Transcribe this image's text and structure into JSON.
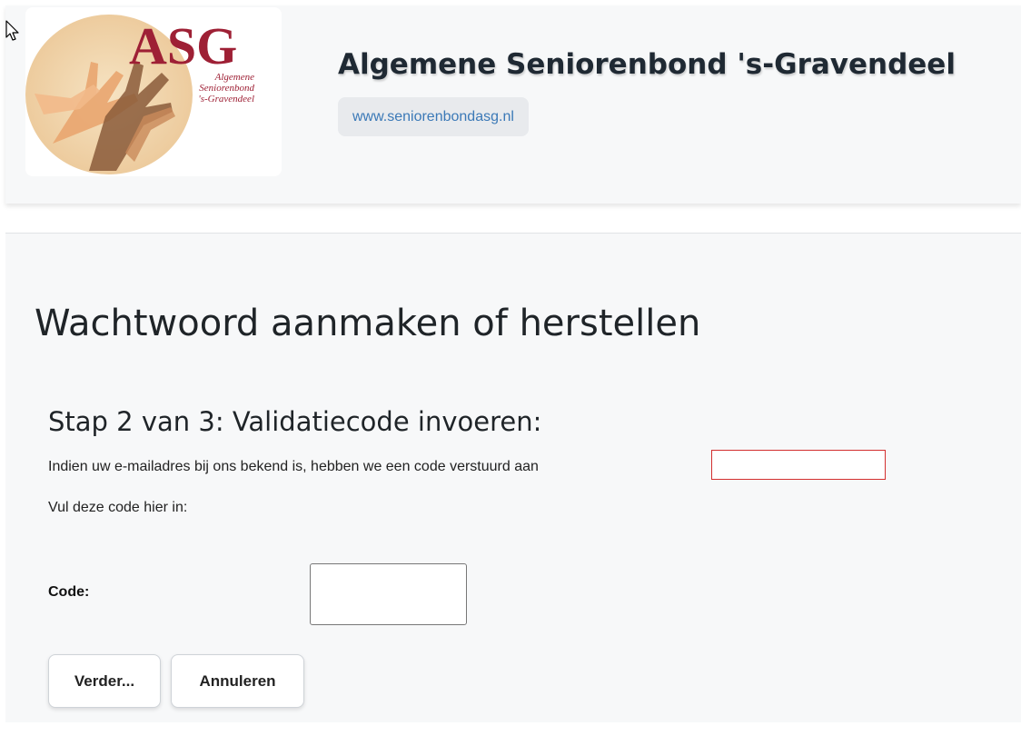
{
  "header": {
    "logo_text": "ASG",
    "logo_subtitle_lines": [
      "Algemene",
      "Seniorenbond",
      "'s-Gravendeel"
    ],
    "title": "Algemene Seniorenbond 's-Gravendeel",
    "url": "www.seniorenbondasg.nl"
  },
  "main": {
    "page_title": "Wachtwoord aanmaken of herstellen",
    "step_title": "Stap 2 van 3: Validatiecode invoeren:",
    "info_text": "Indien uw e-mailadres bij ons bekend is, hebben we een code verstuurd aan",
    "fill_text": "Vul deze code hier in:",
    "code_label": "Code:",
    "code_value": "",
    "buttons": {
      "next": "Verder...",
      "cancel": "Annuleren"
    }
  },
  "colors": {
    "header_bg": "#f7f8f9",
    "title": "#1f2933",
    "link": "#3b79b7",
    "logo_red": "#9e2035",
    "redaction_border": "#d32f2f"
  }
}
